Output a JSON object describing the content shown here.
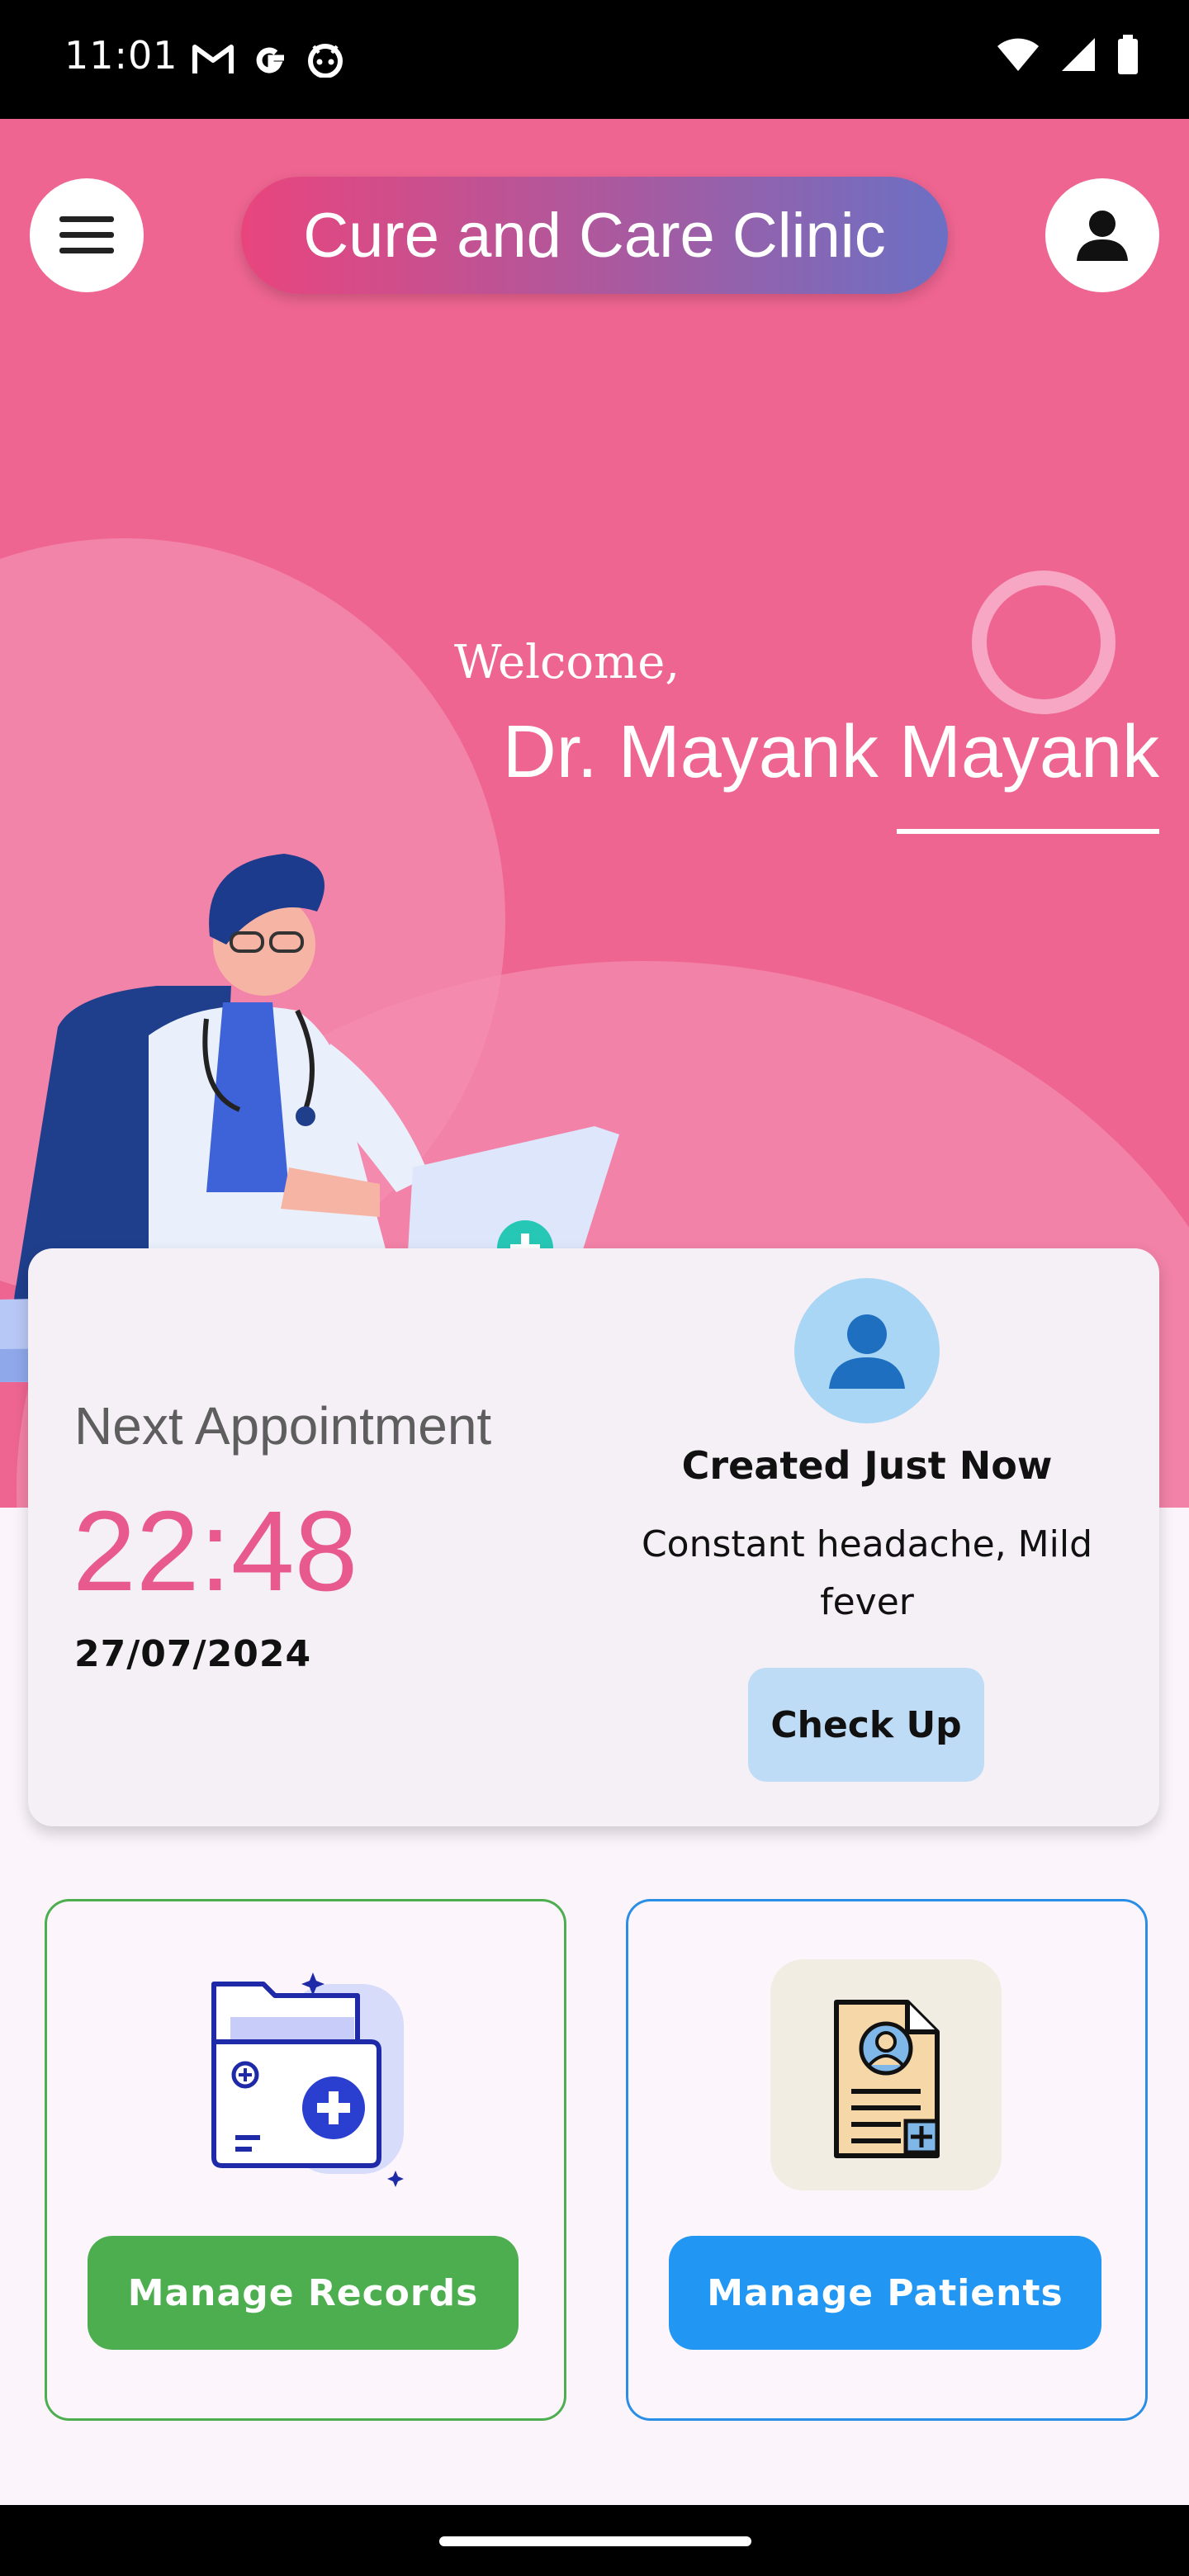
{
  "status_bar": {
    "time": "11:01",
    "left_icons": [
      "gmail-icon",
      "google-icon",
      "android-icon"
    ],
    "right_icons": [
      "wifi-icon",
      "signal-icon",
      "battery-icon"
    ]
  },
  "header": {
    "menu_icon": "hamburger-menu-icon",
    "title": "Cure and Care Clinic",
    "profile_icon": "person-icon"
  },
  "hero": {
    "welcome": "Welcome,",
    "doctor_name": "Dr. Mayank Mayank",
    "illustration": "doctor-at-desk-illustration"
  },
  "appointment": {
    "label": "Next Appointment",
    "time": "22:48",
    "date": "27/07/2024",
    "patient_icon": "person-icon",
    "created": "Created Just Now",
    "complaint": "Constant headache, Mild fever",
    "button": "Check Up"
  },
  "tiles": {
    "records": {
      "icon": "medical-folder-icon",
      "button": "Manage Records",
      "color": "#4cae4f"
    },
    "patients": {
      "icon": "patient-profile-document-icon",
      "button": "Manage Patients",
      "color": "#2196f3"
    }
  },
  "colors": {
    "brand_pink": "#ef6592",
    "accent_pink": "#e85a8d",
    "checkup_button": "#bfdcf6"
  }
}
